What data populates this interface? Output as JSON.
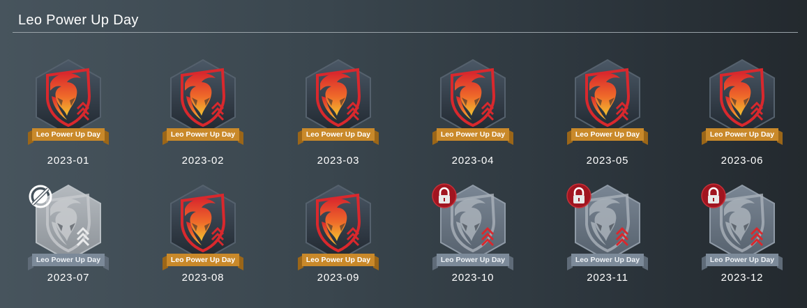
{
  "page": {
    "title": "Leo Power Up Day",
    "colors": {
      "ribbon_earned": "#c9892a",
      "ribbon_locked": "#7c8a99",
      "lock_red": "#a11520",
      "flame_red": "#d9282d",
      "flame_yellow": "#f2c230"
    }
  },
  "badges": [
    {
      "label": "Leo Power Up Day",
      "date": "2023-01",
      "state": "earned"
    },
    {
      "label": "Leo Power Up Day",
      "date": "2023-02",
      "state": "earned"
    },
    {
      "label": "Leo Power Up Day",
      "date": "2023-03",
      "state": "earned"
    },
    {
      "label": "Leo Power Up Day",
      "date": "2023-04",
      "state": "earned"
    },
    {
      "label": "Leo Power Up Day",
      "date": "2023-05",
      "state": "earned"
    },
    {
      "label": "Leo Power Up Day",
      "date": "2023-06",
      "state": "earned"
    },
    {
      "label": "Leo Power Up Day",
      "date": "2023-07",
      "state": "missed"
    },
    {
      "label": "Leo Power Up Day",
      "date": "2023-08",
      "state": "earned"
    },
    {
      "label": "Leo Power Up Day",
      "date": "2023-09",
      "state": "earned"
    },
    {
      "label": "Leo Power Up Day",
      "date": "2023-10",
      "state": "locked"
    },
    {
      "label": "Leo Power Up Day",
      "date": "2023-11",
      "state": "locked"
    },
    {
      "label": "Leo Power Up Day",
      "date": "2023-12",
      "state": "locked"
    }
  ]
}
